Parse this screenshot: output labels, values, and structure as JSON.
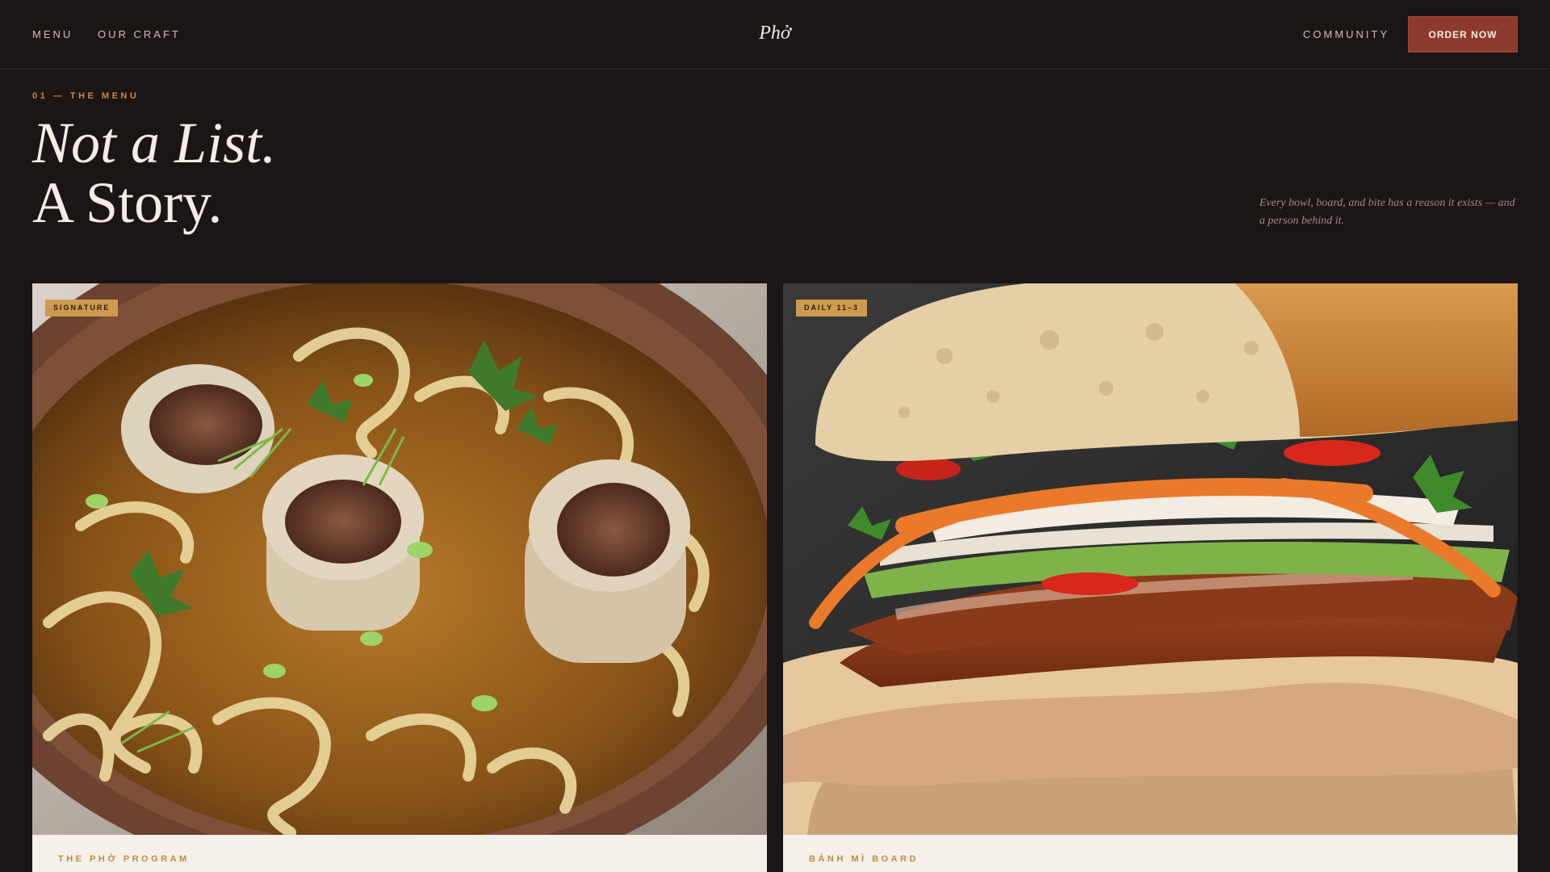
{
  "nav": {
    "left_links": [
      "MENU",
      "OUR CRAFT"
    ],
    "brand": "Phở",
    "right_link": "COMMUNITY",
    "cta": "ORDER NOW"
  },
  "hero": {
    "eyebrow": "01 — THE MENU",
    "headline_line1": "Not a List.",
    "headline_line2": "A Story.",
    "intro": "Every bowl, board, and bite has a reason it exists — and a person behind it."
  },
  "cards": [
    {
      "badge": "SIGNATURE",
      "label": "THE PHỞ PROGRAM",
      "image": "pho-bowl-with-bone-marrow-photo"
    },
    {
      "badge": "DAILY 11–3",
      "label": "BÁNH MÌ BOARD",
      "image": "banh-mi-sandwich-photo"
    }
  ],
  "colors": {
    "background": "#1c1515",
    "accent": "#c58a3e",
    "cta": "#8c3a2e",
    "badge": "#cf9a4e",
    "card_footer": "#f5f0ea"
  }
}
